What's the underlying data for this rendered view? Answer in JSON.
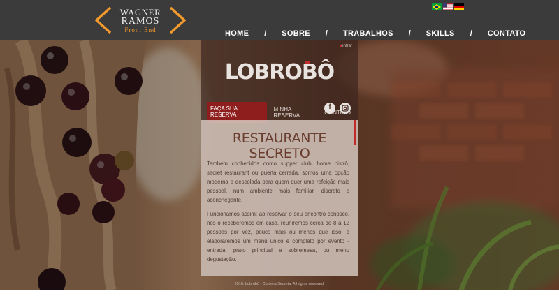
{
  "logo": {
    "line1": "WAGNER",
    "line2": "RAMOS",
    "line3": "Front End",
    "bracket_color": "#f39a2e"
  },
  "flags": [
    {
      "name": "brazil-flag-icon",
      "colors": [
        "#009c3b",
        "#ffdf00",
        "#002776"
      ]
    },
    {
      "name": "usa-flag-icon",
      "colors": [
        "#b22234",
        "#ffffff",
        "#3c3b6e"
      ]
    },
    {
      "name": "germany-flag-icon",
      "colors": [
        "#000000",
        "#dd0000",
        "#ffce00"
      ]
    }
  ],
  "nav": {
    "items": [
      "HOME",
      "SOBRE",
      "TRABALHOS",
      "SKILLS",
      "CONTATO"
    ],
    "separator": "/"
  },
  "showcase": {
    "entrar": "entrar",
    "brand": "LOBROBÔ",
    "menu": [
      "FAÇA SUA RESERVA",
      "MINHA RESERVA",
      "CONTATO"
    ],
    "social": [
      "facebook-icon",
      "instagram-icon"
    ],
    "article_title": "RESTAURANTE SECRETO",
    "paragraph1": "Também conhecidos como supper club, home bistrô, secret restaurant ou puerta cerrada, somos uma opção moderna e descolada para quem quer uma refeição mais pessoal, num ambiente mais familiar, discreto e aconchegante.",
    "paragraph2": "Funcionamos assim: ao reservar o seu encontro conosco, nós o receberemos em casa, reuniremos cerca de 8 a 12 pessoas por vez, pouco mais ou menos que isso, e elaboraremos um menu único e completo por evento - entrada, prato principal e sobremesa, ou menu degustação.",
    "footer": "2016. Lobrobô | Cozinha Secreta. All rights reserved.",
    "accent": "#c32a2a"
  },
  "colors": {
    "header_bg": "#3b3b3b",
    "accent": "#f39a2e"
  }
}
